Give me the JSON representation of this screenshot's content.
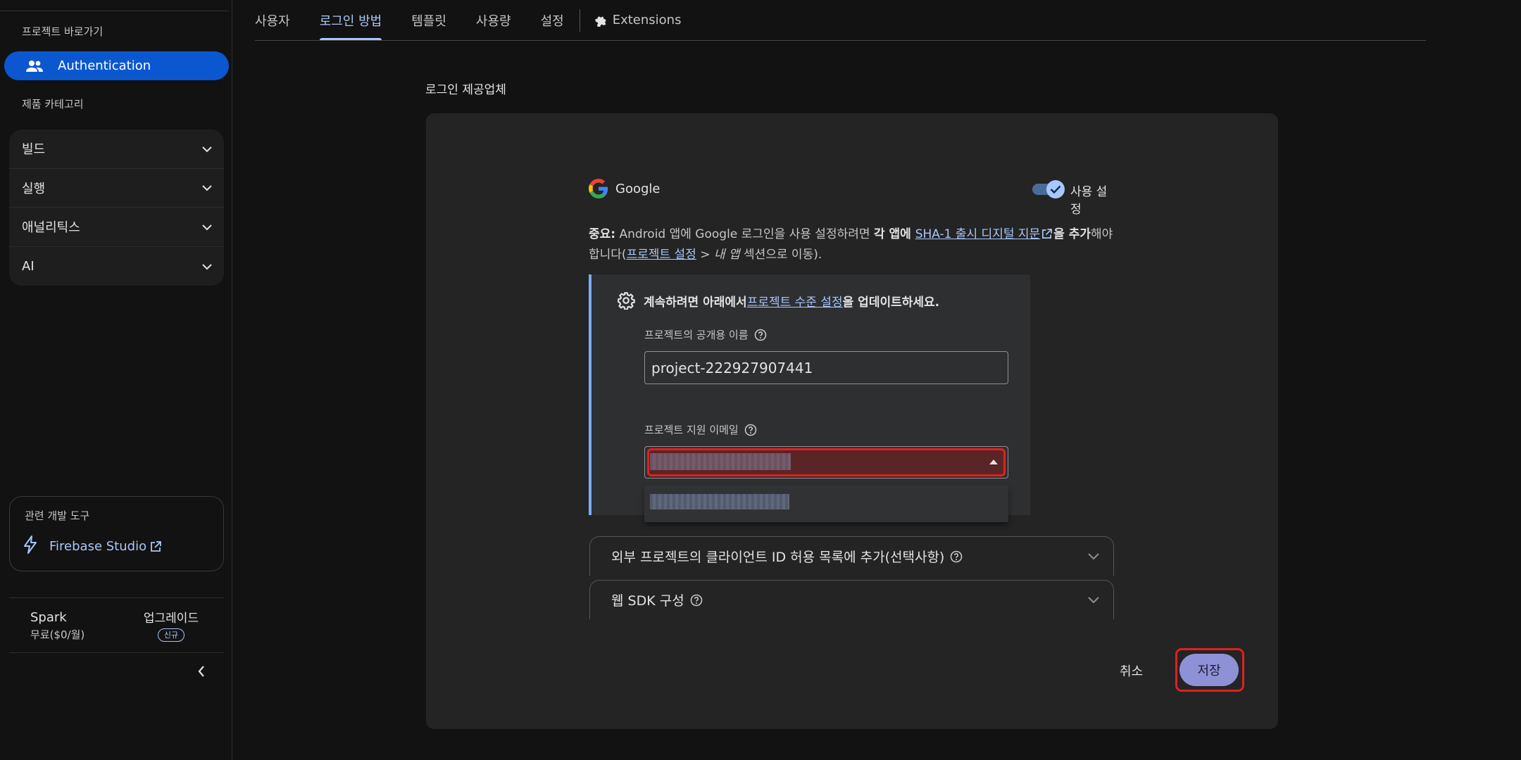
{
  "sidebar": {
    "shortcut_label": "프로젝트 바로가기",
    "active_item": "Authentication",
    "category_label": "제품 카테고리",
    "groups": [
      {
        "label": "빌드"
      },
      {
        "label": "실행"
      },
      {
        "label": "애널리틱스"
      },
      {
        "label": "AI"
      }
    ],
    "tools_title": "관련 개발 도구",
    "tools_link": "Firebase Studio",
    "plan_name": "Spark",
    "plan_price": "무료($0/월)",
    "upgrade_label": "업그레이드",
    "upgrade_badge": "신규"
  },
  "tabs": [
    {
      "label": "사용자",
      "active": false
    },
    {
      "label": "로그인 방법",
      "active": true
    },
    {
      "label": "템플릿",
      "active": false
    },
    {
      "label": "사용량",
      "active": false
    },
    {
      "label": "설정",
      "active": false
    }
  ],
  "extensions_tab": "Extensions",
  "main": {
    "section_title": "로그인 제공업체",
    "provider_name": "Google",
    "toggle_label": "사용 설정",
    "toggle_on": true,
    "notice": {
      "prefix_bold": "중요:",
      "text1": " Android 앱에 Google 로그인을 사용 설정하려면 ",
      "bold1": "각 앱에 ",
      "link1": "SHA-1 출시 디지털 지문",
      "bold2": "을 추가",
      "text2": "해야 합니다(",
      "link2": "프로젝트 설정",
      "text3": " > ",
      "italic": "내 앱",
      "text4": " 섹션으로 이동)."
    },
    "settings_box": {
      "header_prefix": "계속하려면 아래에서 ",
      "header_link": "프로젝트 수준 설정",
      "header_suffix": "을 업데이트하세요.",
      "public_name_label": "프로젝트의 공개용 이름",
      "public_name_value": "project-222927907441",
      "support_email_label": "프로젝트 지원 이메일"
    },
    "accordions": [
      {
        "label": "외부 프로젝트의 클라이언트 ID 허용 목록에 추가(선택사항)"
      },
      {
        "label": "웹 SDK 구성"
      }
    ],
    "cancel_label": "취소",
    "save_label": "저장"
  },
  "colors": {
    "accent": "#a8c7fa",
    "active_nav": "#0b57d0",
    "highlight_red": "#e02020",
    "save_button": "#8f91d6"
  }
}
